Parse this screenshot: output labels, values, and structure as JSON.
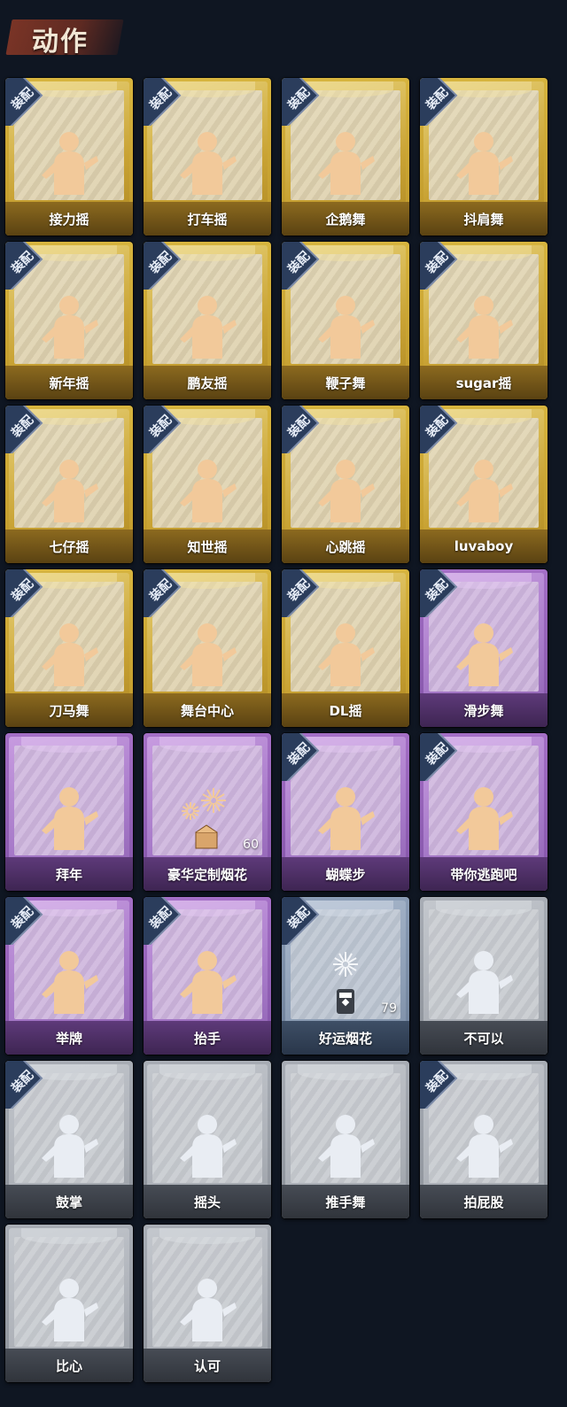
{
  "header": {
    "title": "动作"
  },
  "badge_label": "装配",
  "colors": {
    "gold": "#d7b43e",
    "purple": "#a46fc6",
    "blue": "#8b9db6",
    "gray": "#a8adb5",
    "background": "#0f1622"
  },
  "items": [
    {
      "name": "接力摇",
      "tier": "gold",
      "equipped": true,
      "icon": "dance-figure-icon"
    },
    {
      "name": "打车摇",
      "tier": "gold",
      "equipped": true,
      "icon": "dance-figure-icon"
    },
    {
      "name": "企鹅舞",
      "tier": "gold",
      "equipped": true,
      "icon": "dance-figure-icon"
    },
    {
      "name": "抖肩舞",
      "tier": "gold",
      "equipped": true,
      "icon": "dance-figure-icon"
    },
    {
      "name": "新年摇",
      "tier": "gold",
      "equipped": true,
      "icon": "dance-figure-icon"
    },
    {
      "name": "鹏友摇",
      "tier": "gold",
      "equipped": true,
      "icon": "dance-figure-icon"
    },
    {
      "name": "鞭子舞",
      "tier": "gold",
      "equipped": true,
      "icon": "dance-figure-icon"
    },
    {
      "name": "sugar摇",
      "tier": "gold",
      "equipped": true,
      "icon": "dance-figure-icon"
    },
    {
      "name": "七仔摇",
      "tier": "gold",
      "equipped": true,
      "icon": "dance-figure-icon"
    },
    {
      "name": "知世摇",
      "tier": "gold",
      "equipped": true,
      "icon": "dance-figure-icon"
    },
    {
      "name": "心跳摇",
      "tier": "gold",
      "equipped": true,
      "icon": "dance-figure-icon"
    },
    {
      "name": "luvaboy",
      "tier": "gold",
      "equipped": true,
      "icon": "dance-figure-icon"
    },
    {
      "name": "刀马舞",
      "tier": "gold",
      "equipped": true,
      "icon": "dance-figure-icon"
    },
    {
      "name": "舞台中心",
      "tier": "gold",
      "equipped": true,
      "icon": "dance-figure-icon"
    },
    {
      "name": "DL摇",
      "tier": "gold",
      "equipped": true,
      "icon": "dance-figure-icon"
    },
    {
      "name": "滑步舞",
      "tier": "purple",
      "equipped": true,
      "icon": "dance-figure-icon"
    },
    {
      "name": "拜年",
      "tier": "purple",
      "equipped": false,
      "icon": "bow-figure-icon"
    },
    {
      "name": "豪华定制烟花",
      "tier": "purple",
      "equipped": false,
      "icon": "firework-box-icon",
      "count": "60"
    },
    {
      "name": "蝴蝶步",
      "tier": "purple",
      "equipped": true,
      "icon": "dance-figure-icon"
    },
    {
      "name": "带你逃跑吧",
      "tier": "purple",
      "equipped": true,
      "icon": "dance-figure-icon"
    },
    {
      "name": "举牌",
      "tier": "purple",
      "equipped": true,
      "icon": "hold-sign-icon"
    },
    {
      "name": "抬手",
      "tier": "purple",
      "equipped": true,
      "icon": "raise-hand-icon"
    },
    {
      "name": "好运烟花",
      "tier": "blue",
      "equipped": true,
      "icon": "firework-can-icon",
      "count": "79"
    },
    {
      "name": "不可以",
      "tier": "gray",
      "equipped": false,
      "icon": "finger-wag-icon"
    },
    {
      "name": "鼓掌",
      "tier": "gray",
      "equipped": true,
      "icon": "clap-icon"
    },
    {
      "name": "摇头",
      "tier": "gray",
      "equipped": false,
      "icon": "shake-head-icon"
    },
    {
      "name": "推手舞",
      "tier": "gray",
      "equipped": false,
      "icon": "push-hands-icon"
    },
    {
      "name": "拍屁股",
      "tier": "gray",
      "equipped": true,
      "icon": "slap-icon"
    },
    {
      "name": "比心",
      "tier": "gray",
      "equipped": false,
      "icon": "heart-hand-icon"
    },
    {
      "name": "认可",
      "tier": "gray",
      "equipped": false,
      "icon": "thumbs-up-icon"
    }
  ]
}
